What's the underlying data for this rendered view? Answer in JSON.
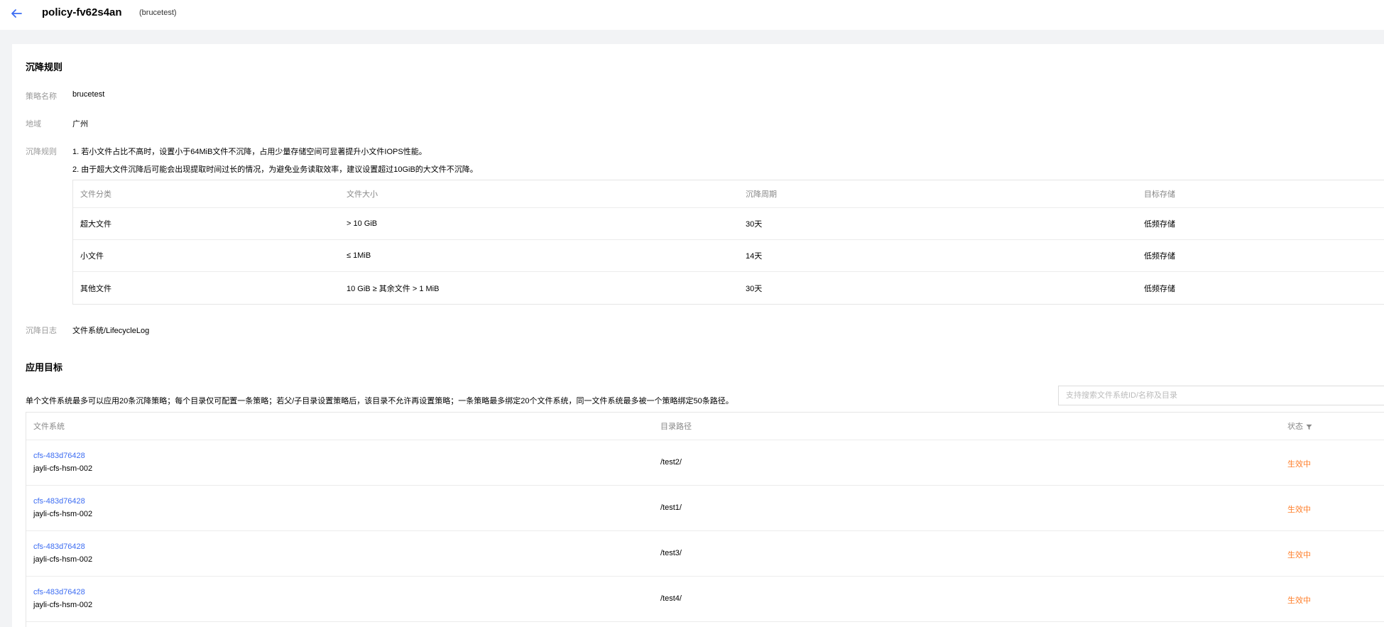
{
  "header": {
    "title": "policy-fv62s4an",
    "subtitle": "(brucetest)"
  },
  "rules_section": {
    "title": "沉降规则",
    "policy_name_label": "策略名称",
    "policy_name_value": "brucetest",
    "region_label": "地域",
    "region_value": "广州",
    "rule_label": "沉降规则",
    "rule_note_1": "1. 若小文件占比不高时，设置小于64MiB文件不沉降，占用少量存储空间可显著提升小文件IOPS性能。",
    "rule_note_2": "2. 由于超大文件沉降后可能会出现提取时间过长的情况，为避免业务读取效率，建议设置超过10GiB的大文件不沉降。",
    "table": {
      "headers": [
        "文件分类",
        "文件大小",
        "沉降周期",
        "目标存储"
      ],
      "rows": [
        [
          "超大文件",
          "> 10 GiB",
          "30天",
          "低频存储"
        ],
        [
          "小文件",
          "≤ 1MiB",
          "14天",
          "低频存储"
        ],
        [
          "其他文件",
          "10 GiB ≥ 其余文件 > 1 MiB",
          "30天",
          "低频存储"
        ]
      ]
    },
    "log_label": "沉降日志",
    "log_value": "文件系统/LifecycleLog"
  },
  "targets_section": {
    "title": "应用目标",
    "note": "单个文件系统最多可以应用20条沉降策略；每个目录仅可配置一条策略；若父/子目录设置策略后，该目录不允许再设置策略；一条策略最多绑定20个文件系统，同一文件系统最多被一个策略绑定50条路径。",
    "search_placeholder": "支持搜索文件系统ID/名称及目录",
    "headers": [
      "文件系统",
      "目录路径",
      "状态"
    ],
    "rows": [
      {
        "fs_id": "cfs-483d76428",
        "fs_name": "jayli-cfs-hsm-002",
        "path": "/test2/",
        "status": "生效中"
      },
      {
        "fs_id": "cfs-483d76428",
        "fs_name": "jayli-cfs-hsm-002",
        "path": "/test1/",
        "status": "生效中"
      },
      {
        "fs_id": "cfs-483d76428",
        "fs_name": "jayli-cfs-hsm-002",
        "path": "/test3/",
        "status": "生效中"
      },
      {
        "fs_id": "cfs-483d76428",
        "fs_name": "jayli-cfs-hsm-002",
        "path": "/test4/",
        "status": "生效中"
      }
    ]
  },
  "icons": {
    "back": "arrow-left-icon",
    "filter": "filter-icon"
  },
  "colors": {
    "link": "#3d6df2",
    "status_active": "#ff7e29",
    "back_arrow": "#3d6df2"
  }
}
